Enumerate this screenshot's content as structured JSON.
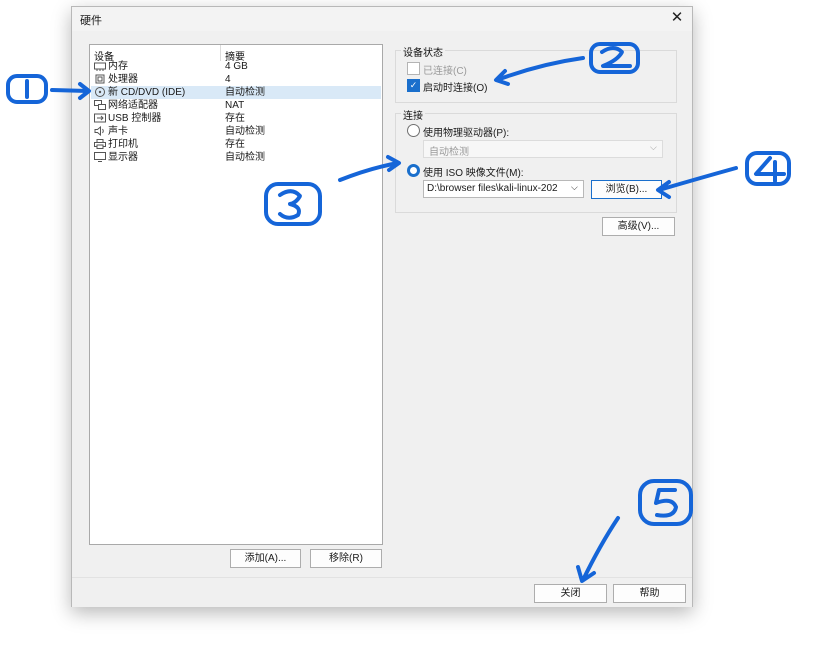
{
  "dialog": {
    "title": "硬件"
  },
  "device_list": {
    "headers": {
      "device": "设备",
      "summary": "摘要"
    },
    "items": [
      {
        "name": "内存",
        "summary": "4 GB"
      },
      {
        "name": "处理器",
        "summary": "4"
      },
      {
        "name": "新 CD/DVD (IDE)",
        "summary": "自动检测"
      },
      {
        "name": "网络适配器",
        "summary": "NAT"
      },
      {
        "name": "USB 控制器",
        "summary": "存在"
      },
      {
        "name": "声卡",
        "summary": "自动检测"
      },
      {
        "name": "打印机",
        "summary": "存在"
      },
      {
        "name": "显示器",
        "summary": "自动检测"
      }
    ],
    "selected_index": 2,
    "add_button": "添加(A)...",
    "remove_button": "移除(R)"
  },
  "device_status": {
    "title": "设备状态",
    "connected": {
      "label": "已连接(C)",
      "checked": false,
      "enabled": false
    },
    "connect_at_power_on": {
      "label": "启动时连接(O)",
      "checked": true
    }
  },
  "connection": {
    "title": "连接",
    "physical_drive": {
      "label": "使用物理驱动器(P):",
      "selected": false,
      "value": "自动检测"
    },
    "iso_image": {
      "label": "使用 ISO 映像文件(M):",
      "selected": true,
      "path": "D:\\browser files\\kali-linux-202"
    },
    "browse_button": "浏览(B)..."
  },
  "advanced_button": "高级(V)...",
  "footer": {
    "close_button": "关闭",
    "help_button": "帮助"
  },
  "annotations": {
    "color": "#1565d8",
    "numbers": [
      "1",
      "2",
      "3",
      "4",
      "5"
    ]
  }
}
